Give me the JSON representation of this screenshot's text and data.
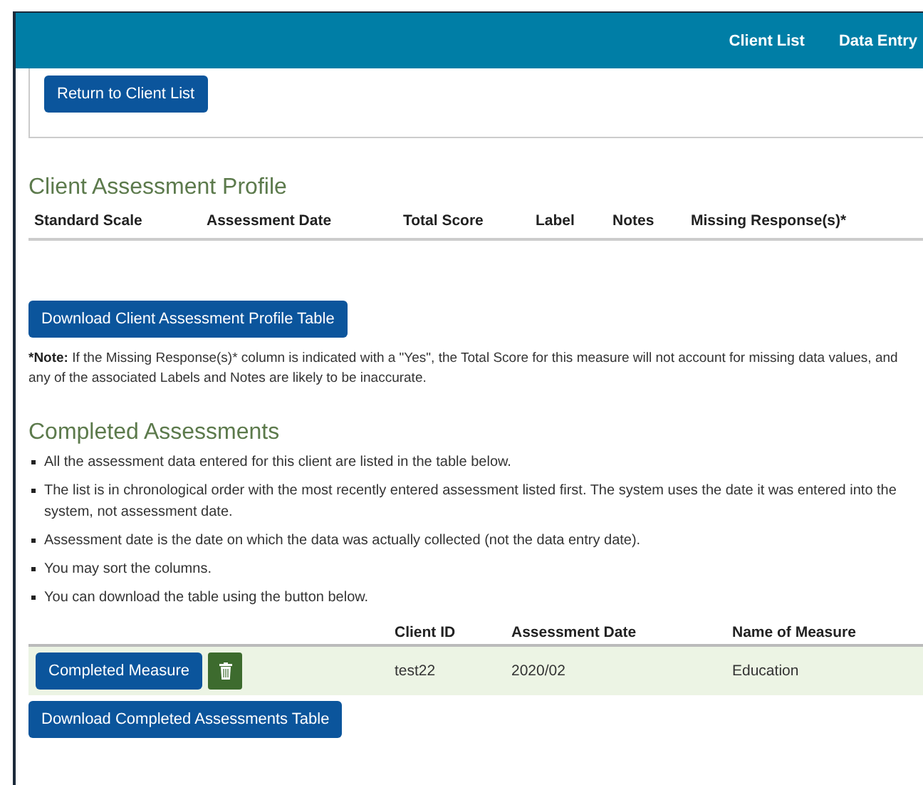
{
  "nav": {
    "links": [
      {
        "label": "Client List"
      },
      {
        "label": "Data Entry"
      }
    ]
  },
  "return_button": "Return to Client List",
  "profile": {
    "title": "Client Assessment Profile",
    "columns": [
      "Standard Scale",
      "Assessment Date",
      "Total Score",
      "Label",
      "Notes",
      "Missing Response(s)*"
    ],
    "download_button": "Download Client Assessment Profile Table",
    "note": {
      "lead": "*Note:",
      "text": "If the Missing Response(s)* column is indicated with a \"Yes\", the Total Score for this measure will not account for missing data values, and any of the associated Labels and Notes are likely to be inaccurate."
    }
  },
  "completed": {
    "title": "Completed Assessments",
    "bullets": [
      "All the assessment data entered for this client are listed in the table below.",
      "The list is in chronological order with the most recently entered assessment listed first. The system uses the date it was entered into the system, not assessment date.",
      "Assessment date is the date on which the data was actually collected (not the data entry date).",
      "You may sort the columns.",
      "You can download the table using the button below."
    ],
    "columns": [
      "Client ID",
      "Assessment Date",
      "Name of Measure"
    ],
    "rows": [
      {
        "action": "Completed Measure",
        "cells": [
          "test22",
          "2020/02",
          "Education"
        ]
      }
    ],
    "download_button": "Download Completed Assessments Table"
  }
}
